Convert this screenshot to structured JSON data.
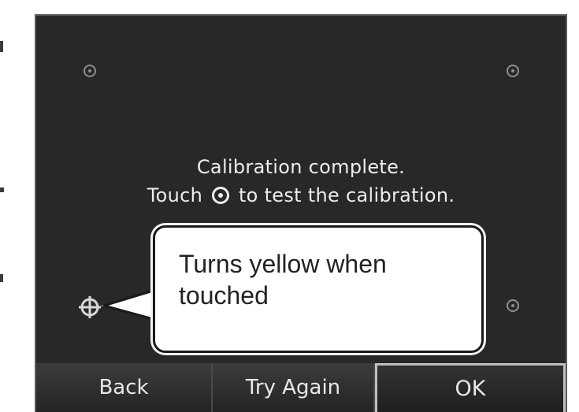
{
  "message": {
    "line1": "Calibration complete.",
    "line2_before": "Touch",
    "line2_after": "to test the calibration."
  },
  "callout": {
    "text_line1": "Turns yellow when",
    "text_line2": "touched"
  },
  "buttons": {
    "back": "Back",
    "try_again": "Try Again",
    "ok": "OK"
  },
  "colors": {
    "screen_background": "#282828",
    "text": "#ececec",
    "target_dot": "#8e8e8e",
    "callout_background": "#ffffff"
  },
  "icons": {
    "calibration_target": "calibration-target-icon",
    "test_crosshair": "crosshair-icon"
  }
}
